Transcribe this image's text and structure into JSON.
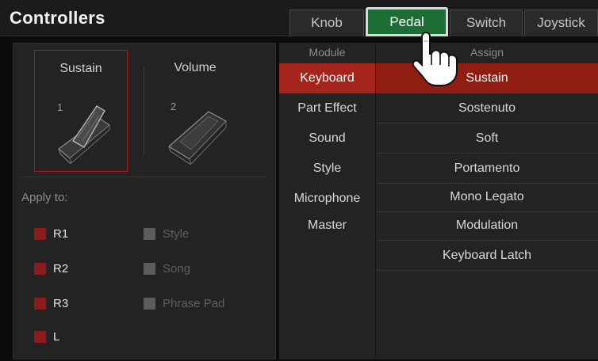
{
  "header": {
    "title": "Controllers",
    "tabs": [
      "Knob",
      "Pedal",
      "Switch",
      "Joystick"
    ],
    "active_tab": "Pedal"
  },
  "pedals": [
    {
      "name": "Sustain",
      "number": "1",
      "selected": true
    },
    {
      "name": "Volume",
      "number": "2",
      "selected": false
    }
  ],
  "apply": {
    "label": "Apply to:",
    "parts": [
      {
        "label": "R1",
        "checked": true
      },
      {
        "label": "R2",
        "checked": true
      },
      {
        "label": "R3",
        "checked": true
      },
      {
        "label": "L",
        "checked": true
      }
    ],
    "targets": [
      {
        "label": "Style",
        "enabled": false
      },
      {
        "label": "Song",
        "enabled": false
      },
      {
        "label": "Phrase Pad",
        "enabled": false
      }
    ]
  },
  "module": {
    "header": "Module",
    "items": [
      "Keyboard",
      "Part Effect",
      "Sound",
      "Style",
      "Microphone",
      "Master"
    ],
    "selected": "Keyboard"
  },
  "assign": {
    "header": "Assign",
    "items": [
      "Sustain",
      "Sostenuto",
      "Soft",
      "Portamento",
      "Mono Legato",
      "Modulation",
      "Keyboard Latch"
    ],
    "selected": "Sustain"
  },
  "colors": {
    "active_tab": "#1c6e35",
    "selection_red": "#a5241c",
    "checkbox_on": "#8c1c1c",
    "checkbox_off": "#5c5c5c"
  },
  "icons": {
    "pointer": "hand-pointer-icon",
    "pedal": "pedal-icon"
  }
}
